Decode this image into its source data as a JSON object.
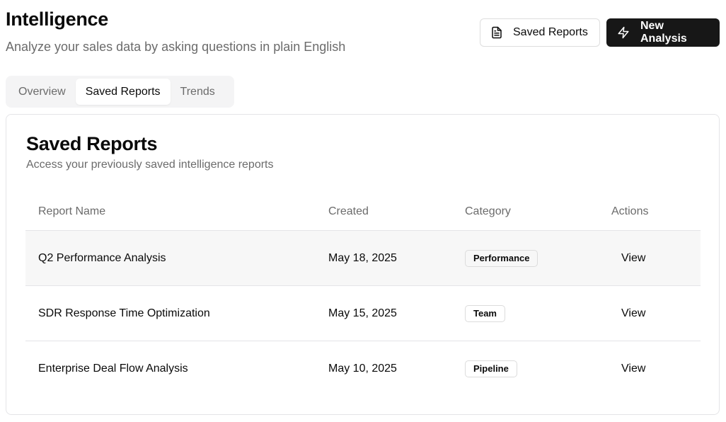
{
  "header": {
    "title": "Intelligence",
    "subtitle": "Analyze your sales data by asking questions in plain English",
    "saved_reports_button": "Saved Reports",
    "new_analysis_button": "New Analysis"
  },
  "tabs": [
    {
      "label": "Overview",
      "active": false
    },
    {
      "label": "Saved Reports",
      "active": true
    },
    {
      "label": "Trends",
      "active": false
    }
  ],
  "card": {
    "title": "Saved Reports",
    "subtitle": "Access your previously saved intelligence reports"
  },
  "table": {
    "columns": [
      "Report Name",
      "Created",
      "Category",
      "Actions"
    ],
    "rows": [
      {
        "name": "Q2 Performance Analysis",
        "created": "May 18, 2025",
        "category": "Performance",
        "action": "View"
      },
      {
        "name": "SDR Response Time Optimization",
        "created": "May 15, 2025",
        "category": "Team",
        "action": "View"
      },
      {
        "name": "Enterprise Deal Flow Analysis",
        "created": "May 10, 2025",
        "category": "Pipeline",
        "action": "View"
      }
    ]
  },
  "icons": {
    "saved_reports_button": "document-icon",
    "new_analysis_button": "lightning-icon"
  },
  "colors": {
    "primary_dark": "#171717",
    "muted_text": "#6b6b6b",
    "border": "#e4e4e7",
    "tab_bg": "#f4f4f5"
  }
}
